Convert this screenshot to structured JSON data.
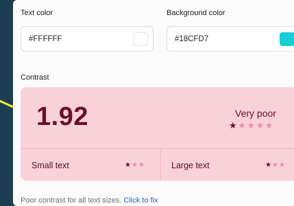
{
  "text_color": {
    "label": "Text color",
    "value": "#FFFFFF",
    "swatch": "#FFFFFF"
  },
  "background_color": {
    "label": "Background color",
    "value": "#18CFD7",
    "swatch": "#18CFD7"
  },
  "contrast": {
    "label": "Contrast",
    "ratio": "1.92",
    "rating_label": "Very poor",
    "stars": {
      "filled": 1,
      "total": 5
    },
    "small_text": {
      "label": "Small text",
      "stars_filled": 1,
      "stars_total": 3
    },
    "large_text": {
      "label": "Large text",
      "stars_filled": 1,
      "stars_total": 3
    },
    "card_color": "#F8D1D9",
    "accent_color": "#6A1026"
  },
  "footer": {
    "message": "Poor contrast for all text sizes.",
    "link": "Click to fix"
  }
}
